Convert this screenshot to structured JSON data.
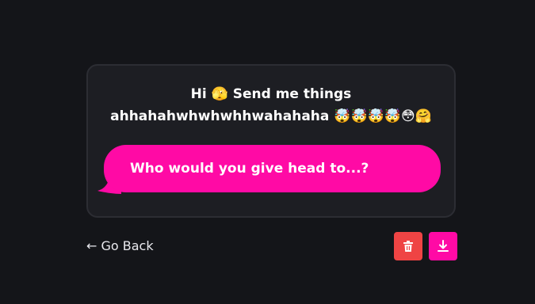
{
  "prompt": {
    "line1": "Hi 🫣 Send me things",
    "line2": "ahhahahwhwhwhhwahahaha 🤯🤯🤯🤯😳🤗"
  },
  "message": {
    "text": "Who would you give head to...?"
  },
  "footer": {
    "back_label": "← Go Back",
    "delete_icon": "trash-icon",
    "download_icon": "download-icon"
  },
  "colors": {
    "background": "#141519",
    "card": "#1d1e23",
    "bubble": "#ff0aa5",
    "delete_button": "#ef4444",
    "download_button": "#ff0aa5"
  }
}
